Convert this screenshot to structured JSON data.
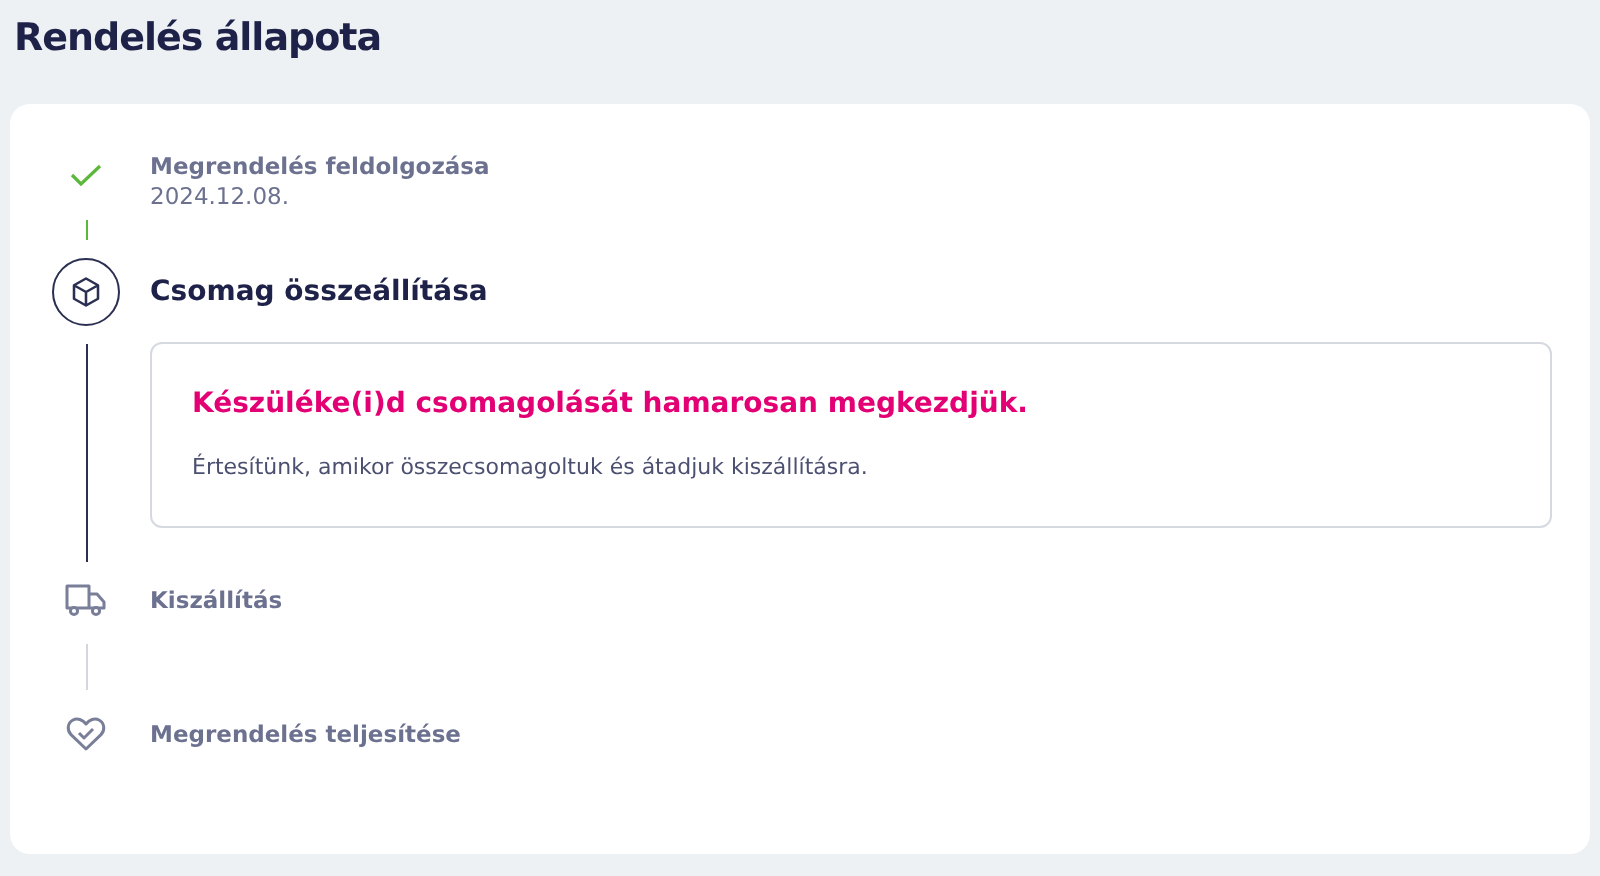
{
  "title": "Rendelés állapota",
  "steps": [
    {
      "kind": "check",
      "completed": true,
      "active": false,
      "title": "Megrendelés feldolgozása",
      "date": "2024.12.08."
    },
    {
      "kind": "package",
      "completed": false,
      "active": true,
      "title": "Csomag összeállítása",
      "details": {
        "heading": "Készüléke(i)d csomagolását hamarosan megkezdjük.",
        "text": "Értesítünk, amikor összecsomagoltuk és átadjuk kiszállításra."
      }
    },
    {
      "kind": "truck",
      "completed": false,
      "active": false,
      "title": "Kiszállítás"
    },
    {
      "kind": "heart",
      "completed": false,
      "active": false,
      "title": "Megrendelés teljesítése"
    }
  ]
}
